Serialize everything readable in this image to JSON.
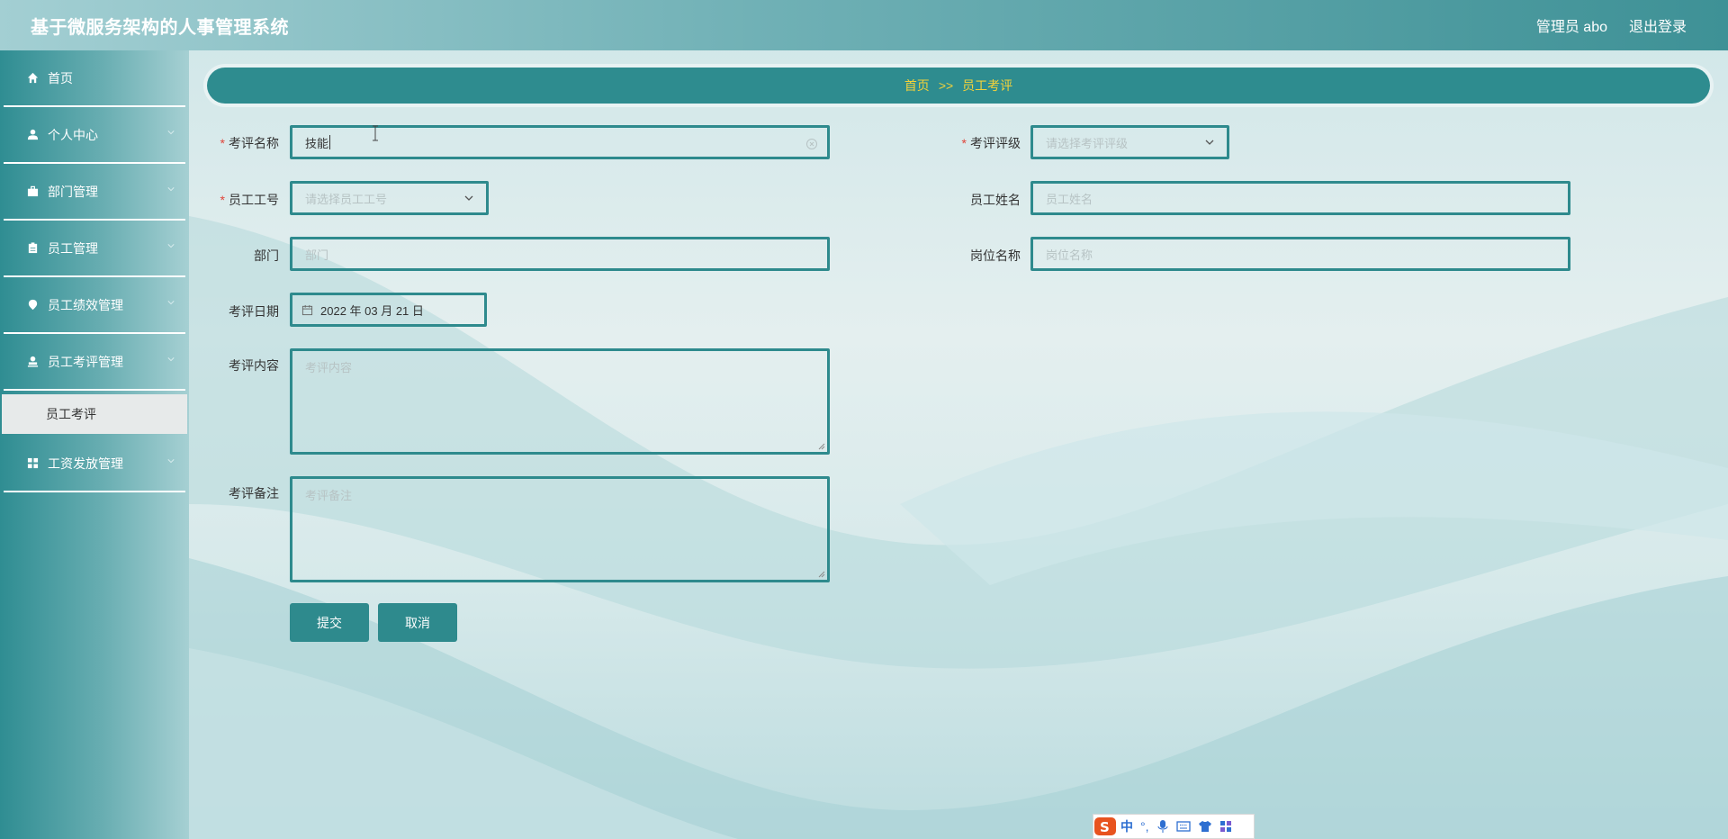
{
  "header": {
    "title": "基于微服务架构的人事管理系统",
    "user": "管理员 abo",
    "logout": "退出登录"
  },
  "sidebar": {
    "items": [
      {
        "label": "首页",
        "icon": "home-icon",
        "has_children": false
      },
      {
        "label": "个人中心",
        "icon": "user-icon",
        "has_children": true
      },
      {
        "label": "部门管理",
        "icon": "briefcase-icon",
        "has_children": true
      },
      {
        "label": "员工管理",
        "icon": "clipboard-icon",
        "has_children": true
      },
      {
        "label": "员工绩效管理",
        "icon": "location-icon",
        "has_children": true
      },
      {
        "label": "员工考评管理",
        "icon": "person-stamp-icon",
        "has_children": true,
        "expanded": true
      },
      {
        "label": "工资发放管理",
        "icon": "grid-icon",
        "has_children": true
      }
    ],
    "submenu": {
      "label": "员工考评"
    }
  },
  "breadcrumb": {
    "home": "首页",
    "separator": ">>",
    "current": "员工考评"
  },
  "form": {
    "evaluation_name": {
      "label": "考评名称",
      "value": "技能",
      "required": true
    },
    "evaluation_grade": {
      "label": "考评评级",
      "placeholder": "请选择考评评级",
      "required": true
    },
    "employee_id": {
      "label": "员工工号",
      "placeholder": "请选择员工工号",
      "required": true
    },
    "employee_name": {
      "label": "员工姓名",
      "placeholder": "员工姓名"
    },
    "department": {
      "label": "部门",
      "placeholder": "部门"
    },
    "position": {
      "label": "岗位名称",
      "placeholder": "岗位名称"
    },
    "evaluation_date": {
      "label": "考评日期",
      "value": "2022 年 03 月 21 日"
    },
    "evaluation_content": {
      "label": "考评内容",
      "placeholder": "考评内容"
    },
    "evaluation_note": {
      "label": "考评备注",
      "placeholder": "考评备注"
    }
  },
  "buttons": {
    "submit": "提交",
    "cancel": "取消"
  },
  "ime": {
    "lang": "中",
    "punct": "°,"
  },
  "colors": {
    "accent": "#2e8a8d",
    "breadcrumb_text": "#f3d23a",
    "required": "#e0453a"
  }
}
